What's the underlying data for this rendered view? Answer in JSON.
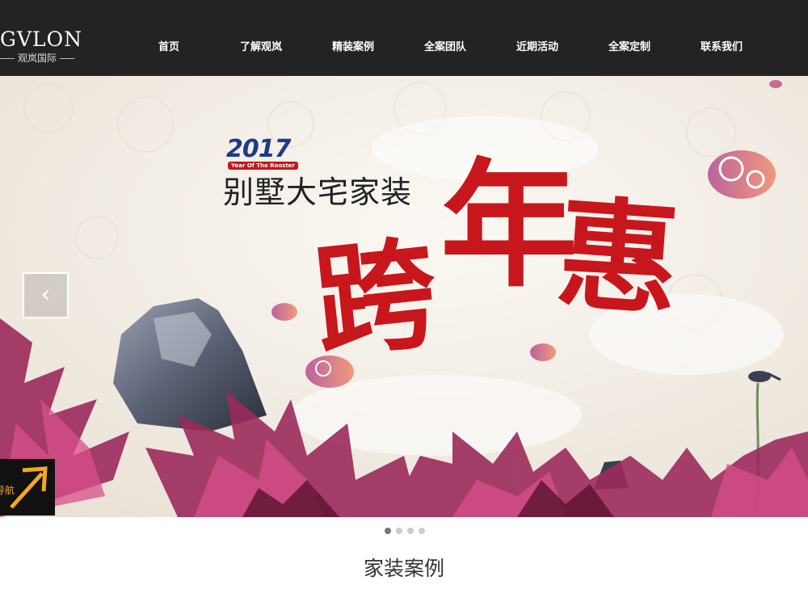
{
  "header": {
    "logo_main": "GVLON",
    "logo_sub": "观岚国际",
    "nav": [
      "首页",
      "了解观岚",
      "精装案例",
      "全案团队",
      "近期活动",
      "全案定制",
      "联系我们"
    ]
  },
  "banner": {
    "year": "2017",
    "year_tag": "Year Of The Rooster",
    "slogan": "别墅大宅家装",
    "calligraphy": [
      "跨",
      "年",
      "惠"
    ],
    "prev_glyph": "‹",
    "guide_label": "导航"
  },
  "carousel": {
    "slides": 4,
    "active": 0
  },
  "section": {
    "title": "家装案例"
  },
  "colors": {
    "header_bg": "#232323",
    "accent_red": "#c8161d",
    "title_blue": "#1f3a8a"
  }
}
